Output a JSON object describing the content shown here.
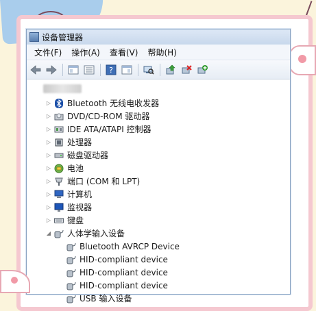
{
  "window": {
    "title": "设备管理器"
  },
  "menu": [
    {
      "label": "文件(F)"
    },
    {
      "label": "操作(A)"
    },
    {
      "label": "查看(V)"
    },
    {
      "label": "帮助(H)"
    }
  ],
  "toolbar": {
    "buttons": [
      "back-icon",
      "forward-icon",
      "properties-pane-icon",
      "list-view-icon",
      "help-icon",
      "console-tree-icon",
      "scan-hardware-icon",
      "update-driver-icon",
      "uninstall-device-icon",
      "enable-device-icon"
    ]
  },
  "tree": {
    "categories": [
      {
        "label": "Bluetooth 无线电收发器",
        "icon": "bluetooth-icon",
        "expanded": false
      },
      {
        "label": "DVD/CD-ROM 驱动器",
        "icon": "dvd-drive-icon",
        "expanded": false
      },
      {
        "label": "IDE ATA/ATAPI 控制器",
        "icon": "ide-controller-icon",
        "expanded": false
      },
      {
        "label": "处理器",
        "icon": "processor-icon",
        "expanded": false
      },
      {
        "label": "磁盘驱动器",
        "icon": "disk-drive-icon",
        "expanded": false
      },
      {
        "label": "电池",
        "icon": "battery-icon",
        "expanded": false
      },
      {
        "label": "端口 (COM 和 LPT)",
        "icon": "port-icon",
        "expanded": false
      },
      {
        "label": "计算机",
        "icon": "computer-icon",
        "expanded": false
      },
      {
        "label": "监视器",
        "icon": "monitor-icon",
        "expanded": false
      },
      {
        "label": "键盘",
        "icon": "keyboard-icon",
        "expanded": false
      },
      {
        "label": "人体学输入设备",
        "icon": "hid-icon",
        "expanded": true
      }
    ],
    "hid_children": [
      {
        "label": "Bluetooth AVRCP Device"
      },
      {
        "label": "HID-compliant device"
      },
      {
        "label": "HID-compliant device"
      },
      {
        "label": "HID-compliant device"
      },
      {
        "label": "USB 输入设备"
      }
    ]
  }
}
